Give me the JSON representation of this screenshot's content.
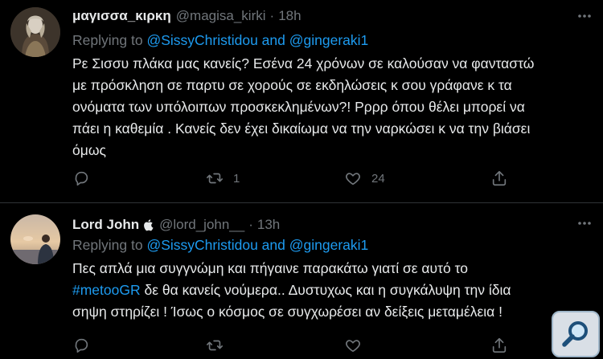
{
  "colors": {
    "background": "#000000",
    "text": "#e7e9ea",
    "muted": "#71767b",
    "link": "#1d9bf0",
    "divider": "#2f3336"
  },
  "tweets": [
    {
      "display_name": "μαγισσα_κιρκη",
      "handle": "@magisa_kirki",
      "separator": "·",
      "time": "18h",
      "replying_prefix": "Replying to",
      "replying_user1": "@SissyChristidou",
      "replying_and": "and",
      "replying_user2": "@gingeraki1",
      "body_lines": [
        "Ρε Σισσυ πλάκα μας κανείς? Εσένα 24 χρόνων σε καλούσαν να φανταστώ",
        "με πρόσκληση σε παρτυ σε χορούς σε εκδηλώσεις κ σου γράφανε κ τα",
        "ονόματα των υπόλοιπων προσκεκλημένων?! Ρρρρ όπου θέλει μπορεί να",
        "πάει η καθεμία . Κανείς δεν έχει δικαίωμα να την ναρκώσει κ να την βιάσει",
        "όμως"
      ],
      "actions": {
        "reply_icon": "reply-icon",
        "retweet_icon": "retweet-icon",
        "retweet_count": "1",
        "like_icon": "heart-icon",
        "like_count": "24",
        "share_icon": "share-icon"
      }
    },
    {
      "display_name": "Lord John",
      "verified_badge_icon": "apple-icon",
      "handle": "@lord_john__",
      "separator": "·",
      "time": "13h",
      "replying_prefix": "Replying to",
      "replying_user1": "@SissyChristidou",
      "replying_and": "and",
      "replying_user2": "@gingeraki1",
      "body_line1": "Πες απλά μια συγγνώμη και πήγαινε παρακάτω γιατί σε αυτό το",
      "body_hashtag": "#metooGR",
      "body_line2_rest": " δε θα κανείς νούμερα.. Δυστυχως και η συγκάλυψη την ίδια",
      "body_line3": "σηψη στηρίζει ! Ίσως ο κόσμος σε συγχωρέσει αν δείξεις μεταμέλεια !",
      "actions": {
        "reply_icon": "reply-icon",
        "retweet_icon": "retweet-icon",
        "like_icon": "heart-icon",
        "share_icon": "share-icon"
      }
    }
  ],
  "overlay": {
    "icon": "magnifier-icon"
  }
}
